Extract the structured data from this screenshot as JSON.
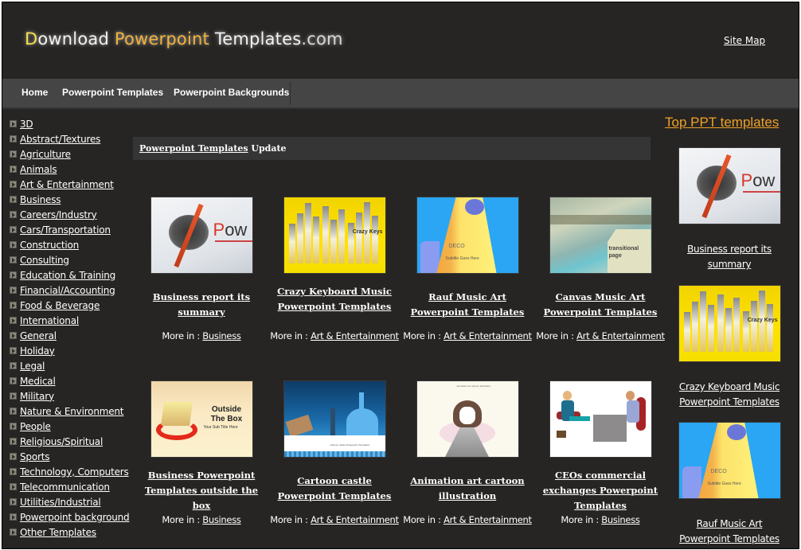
{
  "header": {
    "logo": {
      "part1_first": "D",
      "part1_rest": "ownload ",
      "part2": "Powerpoint",
      "part3": " Templates",
      "part4": ".com"
    },
    "site_map": "Site Map"
  },
  "nav": {
    "items": [
      {
        "label": "Home"
      },
      {
        "label": "Powerpoint Templates"
      },
      {
        "label": "Powerpoint Backgrounds"
      }
    ]
  },
  "sidebar": {
    "categories": [
      "3D",
      "Abstract/Textures",
      "Agriculture",
      "Animals",
      "Art & Entertainment",
      "Business",
      "Careers/Industry",
      "Cars/Transportation",
      "Construction",
      "Consulting",
      "Education & Training",
      "Financial/Accounting",
      "Food & Beverage",
      "International",
      "General",
      "Holiday",
      "Legal",
      "Medical",
      "Military",
      "Nature & Environment",
      "People",
      "Religious/Spiritual",
      "Sports",
      "Technology, Computers",
      "Telecommunication",
      "Utilities/Industrial",
      "Powerpoint background",
      "Other Templates"
    ]
  },
  "main": {
    "update_link": "Powerpoint Templates",
    "update_suffix": " Update",
    "more_in_label": "More in : ",
    "cards": [
      {
        "title": "Business report its summary",
        "category": "Business",
        "thumb": "compass"
      },
      {
        "title": "Crazy Keyboard Music Powerpoint Templates",
        "category": "Art & Entertainment",
        "thumb": "keys",
        "thumb_text": "Crazy Keys"
      },
      {
        "title": "Rauf Music Art Powerpoint Templates",
        "category": "Art & Entertainment",
        "thumb": "deco",
        "thumb_text": "DECO",
        "thumb_sub": "Subtitle Goes Here"
      },
      {
        "title": "Canvas Music Art Powerpoint Templates",
        "category": "Art & Entertainment",
        "thumb": "canvas",
        "thumb_text": "transitional page"
      },
      {
        "title": "Business Powerpoint Templates outside the box",
        "category": "Business",
        "thumb": "box",
        "thumb_text": "Outside The Box",
        "thumb_sub": "Your Sub Title Here"
      },
      {
        "title": "Cartoon castle Powerpoint Templates",
        "category": "Art & Entertainment",
        "thumb": "castle",
        "thumb_text": "Cartoon castle Powerpoint Templates"
      },
      {
        "title": "Animation art cartoon illustration",
        "category": "Art & Entertainment",
        "thumb": "anime",
        "thumb_text": "Animation art cartoon illustration"
      },
      {
        "title": "CEOs commercial exchanges Powerpoint Templates",
        "category": "Business",
        "thumb": "ceo"
      }
    ]
  },
  "right": {
    "title": "Top PPT templates",
    "items": [
      {
        "title": "Business report its summary",
        "thumb": "compass"
      },
      {
        "title": "Crazy Keyboard Music Powerpoint Templates",
        "thumb": "keys",
        "thumb_text": "Crazy Keys"
      },
      {
        "title": "Rauf Music Art Powerpoint Templates",
        "thumb": "deco",
        "thumb_text": "DECO",
        "thumb_sub": "Subtitle Goes Here"
      }
    ]
  },
  "colors": {
    "background": "#272523",
    "nav": "#454545",
    "accent_orange": "#f0a028",
    "logo_yellow": "#f6e04a"
  }
}
